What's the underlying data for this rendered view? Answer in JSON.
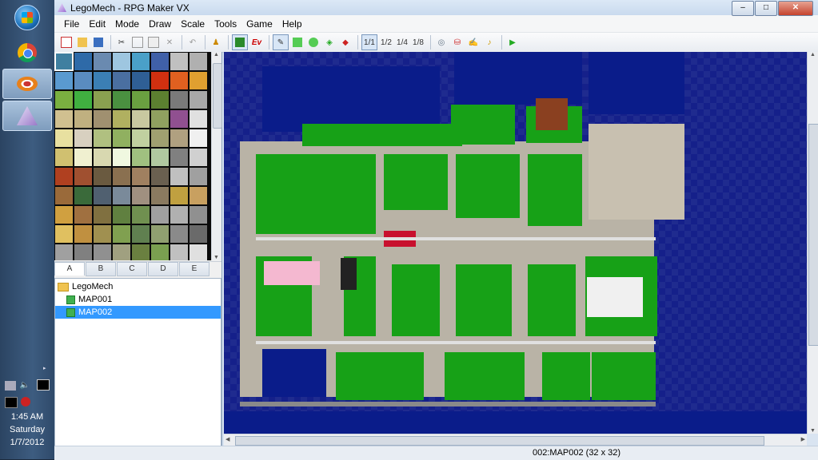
{
  "window": {
    "title": "LegoMech - RPG Maker VX",
    "minimize": "–",
    "maximize": "□",
    "close": "✕"
  },
  "menu": [
    "File",
    "Edit",
    "Mode",
    "Draw",
    "Scale",
    "Tools",
    "Game",
    "Help"
  ],
  "toolbar": {
    "new_icon": "new-icon",
    "open_icon": "open-icon",
    "save_icon": "save-icon",
    "cut_icon": "cut-icon",
    "copy_icon": "copy-icon",
    "paste_icon": "paste-icon",
    "delete_icon": "delete-icon",
    "undo_icon": "undo-icon",
    "ev_label": "Ev",
    "scale_1": "1/1",
    "scale_2": "1/2",
    "scale_4": "1/4",
    "scale_8": "1/8"
  },
  "taskbar": {
    "time": "1:45 AM",
    "day": "Saturday",
    "date": "1/7/2012"
  },
  "tileset_tabs": [
    "A",
    "B",
    "C",
    "D",
    "E"
  ],
  "tree": {
    "root": "LegoMech",
    "maps": [
      "MAP001",
      "MAP002"
    ],
    "selected": "MAP002"
  },
  "status": {
    "text": "002:MAP002 (32 x 32)"
  },
  "colors": {
    "ocean": "#1f2b8f",
    "grass": "#17a117",
    "road": "#b9b3a6",
    "selection": "#3399ff"
  }
}
